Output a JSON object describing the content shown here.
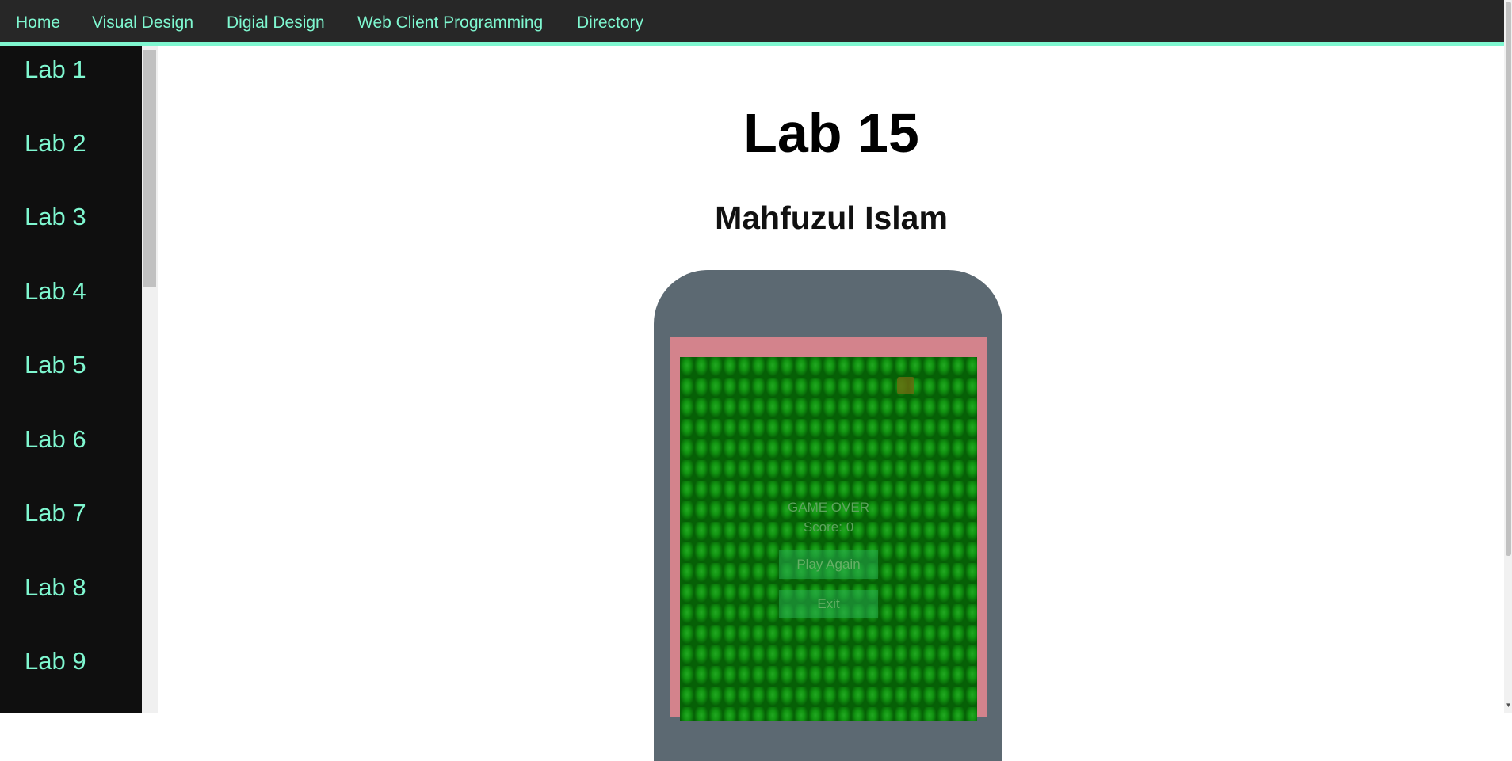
{
  "topnav": {
    "links": [
      "Home",
      "Visual Design",
      "Digial Design",
      "Web Client Programming",
      "Directory"
    ]
  },
  "sidebar": {
    "items": [
      "Lab 1",
      "Lab 2",
      "Lab 3",
      "Lab 4",
      "Lab 5",
      "Lab 6",
      "Lab 7",
      "Lab 8",
      "Lab 9"
    ]
  },
  "page": {
    "title": "Lab 15",
    "subtitle": "Mahfuzul Islam"
  },
  "game": {
    "status": "GAME OVER",
    "score_text": "Score: 0",
    "play_again_label": "Play Again",
    "exit_label": "Exit"
  },
  "colors": {
    "accent": "#7ff7d0",
    "nav_bg": "#272727",
    "sidebar_bg": "#0f0f0f",
    "phone_body": "#5c6972",
    "screen_border": "#d3838c",
    "game_bg": "#0e7d0e"
  }
}
